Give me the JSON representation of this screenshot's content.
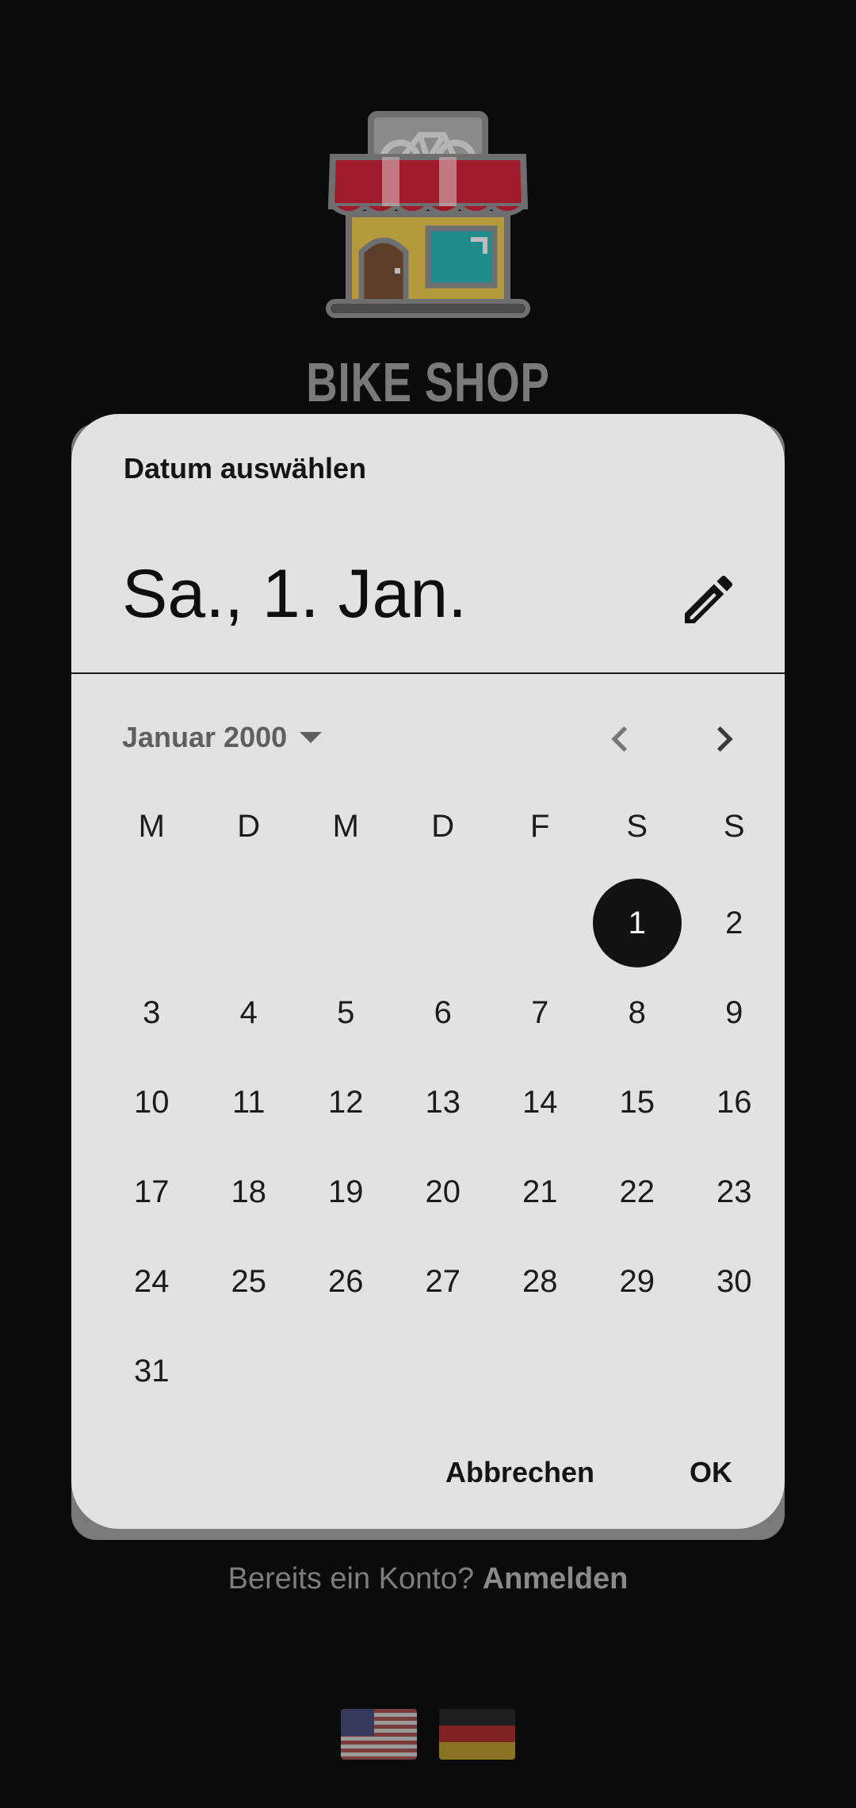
{
  "app": {
    "brand": "BIKE SHOP",
    "login_prompt": "Bereits ein Konto?",
    "login_link": "Anmelden",
    "flags": [
      "us-flag-icon",
      "de-flag-icon"
    ]
  },
  "dialog": {
    "title": "Datum auswählen",
    "selected_date": "Sa., 1. Jan.",
    "edit_icon": "pencil-icon",
    "month_label": "Januar 2000",
    "weekdays": [
      "M",
      "D",
      "M",
      "D",
      "F",
      "S",
      "S"
    ],
    "weeks": [
      [
        "",
        "",
        "",
        "",
        "",
        "1",
        "2"
      ],
      [
        "3",
        "4",
        "5",
        "6",
        "7",
        "8",
        "9"
      ],
      [
        "10",
        "11",
        "12",
        "13",
        "14",
        "15",
        "16"
      ],
      [
        "17",
        "18",
        "19",
        "20",
        "21",
        "22",
        "23"
      ],
      [
        "24",
        "25",
        "26",
        "27",
        "28",
        "29",
        "30"
      ],
      [
        "31",
        "",
        "",
        "",
        "",
        "",
        ""
      ]
    ],
    "selected_day": "1",
    "cancel_label": "Abbrechen",
    "ok_label": "OK"
  },
  "colors": {
    "background": "#0b0b0b",
    "dialog_surface": "#e2e2e2",
    "selected_day": "#121212"
  }
}
